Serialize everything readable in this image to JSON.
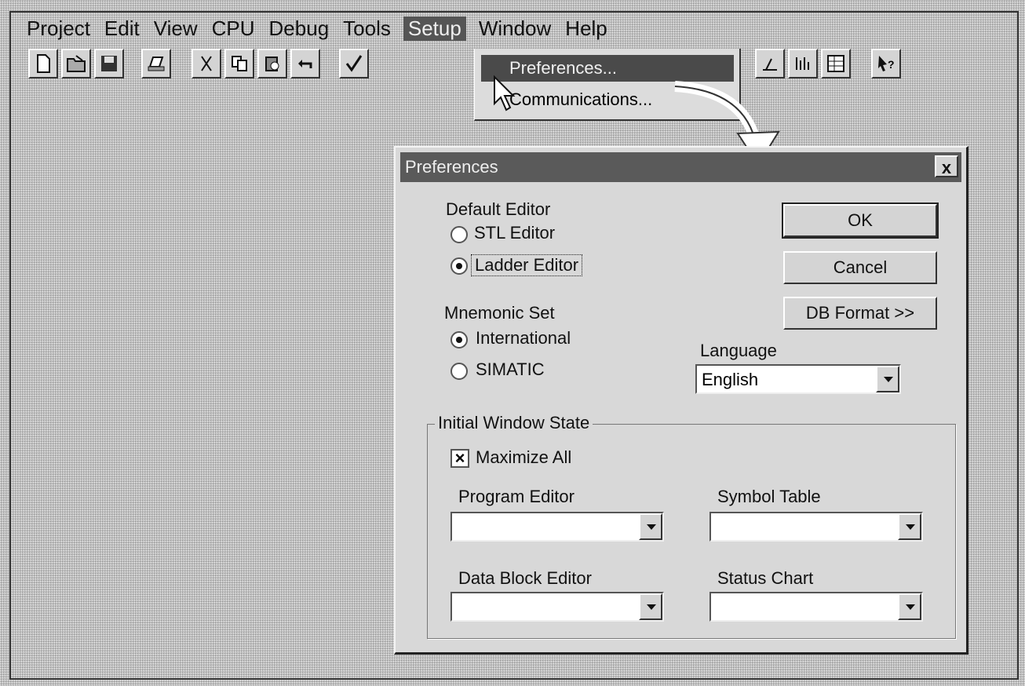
{
  "menubar": {
    "items": [
      "Project",
      "Edit",
      "View",
      "CPU",
      "Debug",
      "Tools",
      "Setup",
      "Window",
      "Help"
    ]
  },
  "toolbar": {
    "buttons": [
      "new-icon",
      "open-icon",
      "save-icon",
      "print-icon",
      "cut-icon",
      "copy-icon",
      "paste-icon",
      "undo-icon",
      "check-icon",
      "status-icon",
      "chart-icon",
      "table-icon",
      "help-icon"
    ]
  },
  "setup_menu": {
    "items": [
      "Preferences...",
      "Communications..."
    ]
  },
  "dialog": {
    "title": "Preferences",
    "close": "x",
    "default_editor": {
      "title": "Default Editor",
      "options": [
        "STL Editor",
        "Ladder Editor"
      ],
      "selected": "Ladder Editor"
    },
    "mnemonic_set": {
      "title": "Mnemonic Set",
      "options": [
        "International",
        "SIMATIC"
      ],
      "selected": "International"
    },
    "buttons": {
      "ok": "OK",
      "cancel": "Cancel",
      "db_format": "DB Format >>"
    },
    "language": {
      "label": "Language",
      "value": "English"
    },
    "initial_window_state": {
      "title": "Initial Window State",
      "maximize_all": "Maximize All",
      "maximize_checked": true,
      "program_editor": "Program Editor",
      "symbol_table": "Symbol Table",
      "data_block_editor": "Data Block Editor",
      "status_chart": "Status Chart"
    }
  }
}
